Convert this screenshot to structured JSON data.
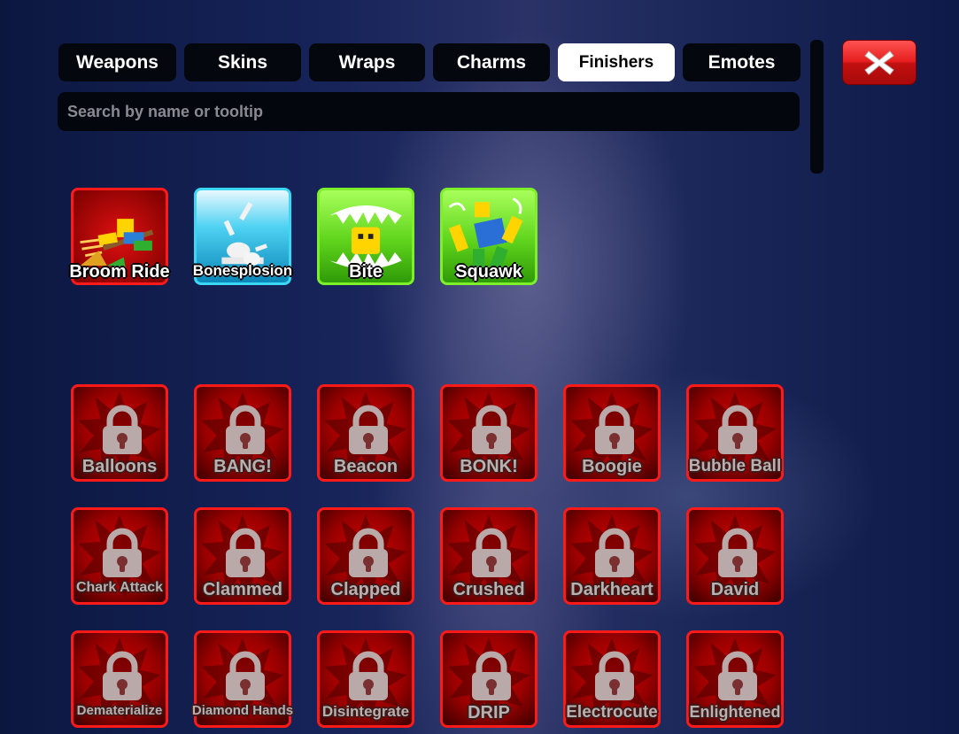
{
  "tabs": [
    {
      "label": "Weapons",
      "active": false
    },
    {
      "label": "Skins",
      "active": false
    },
    {
      "label": "Wraps",
      "active": false
    },
    {
      "label": "Charms",
      "active": false
    },
    {
      "label": "Finishers",
      "active": true
    },
    {
      "label": "Emotes",
      "active": false
    }
  ],
  "search": {
    "placeholder": "Search by name or tooltip",
    "value": ""
  },
  "close_button": {
    "icon": "close-x-icon",
    "color": "#e61e1e"
  },
  "owned": [
    {
      "name": "Broom Ride",
      "border": "#ff1a1a",
      "icon": "broom-ride-icon"
    },
    {
      "name": "Bonesplosion",
      "border": "#3ad8f5",
      "icon": "bones-icon"
    },
    {
      "name": "Bite",
      "border": "#7ef02a",
      "icon": "jaws-icon"
    },
    {
      "name": "Squawk",
      "border": "#7ef02a",
      "icon": "feathers-icon"
    }
  ],
  "locked": [
    {
      "name": "Balloons"
    },
    {
      "name": "BANG!"
    },
    {
      "name": "Beacon"
    },
    {
      "name": "BONK!"
    },
    {
      "name": "Boogie"
    },
    {
      "name": "Bubble Ball"
    },
    {
      "name": "Chark Attack"
    },
    {
      "name": "Clammed"
    },
    {
      "name": "Clapped"
    },
    {
      "name": "Crushed"
    },
    {
      "name": "Darkheart"
    },
    {
      "name": "David"
    },
    {
      "name": "Dematerialize"
    },
    {
      "name": "Diamond Hands"
    },
    {
      "name": "Disintegrate"
    },
    {
      "name": "DRIP"
    },
    {
      "name": "Electrocute"
    },
    {
      "name": "Enlightened"
    }
  ],
  "colors": {
    "locked_border": "#ff1a1a",
    "locked_fill": "#c80000",
    "lock_icon": "#b9a9a9"
  }
}
